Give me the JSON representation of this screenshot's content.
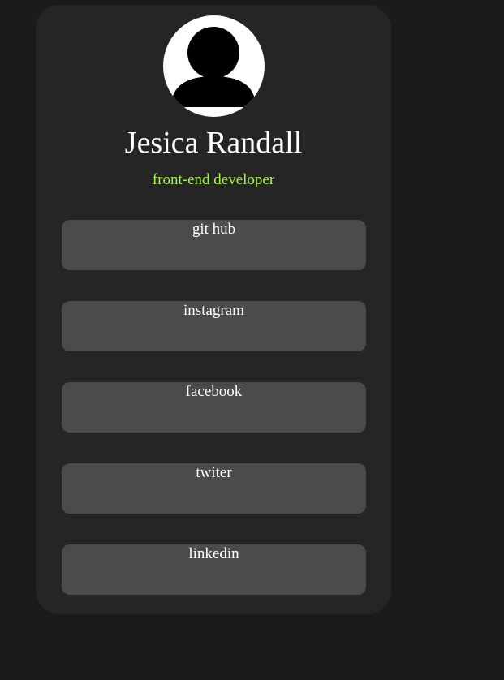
{
  "profile": {
    "name": "Jesica Randall",
    "role": "front-end developer",
    "avatar_icon": "user-silhouette-icon"
  },
  "links": [
    {
      "label": "git hub"
    },
    {
      "label": "instagram"
    },
    {
      "label": "facebook"
    },
    {
      "label": "twiter"
    },
    {
      "label": "linkedin"
    }
  ],
  "colors": {
    "page_background": "#1b1b1b",
    "card_background": "#252525",
    "button_background": "#4c4b4c",
    "role_accent": "#a6f24a",
    "text": "#ffffff"
  }
}
